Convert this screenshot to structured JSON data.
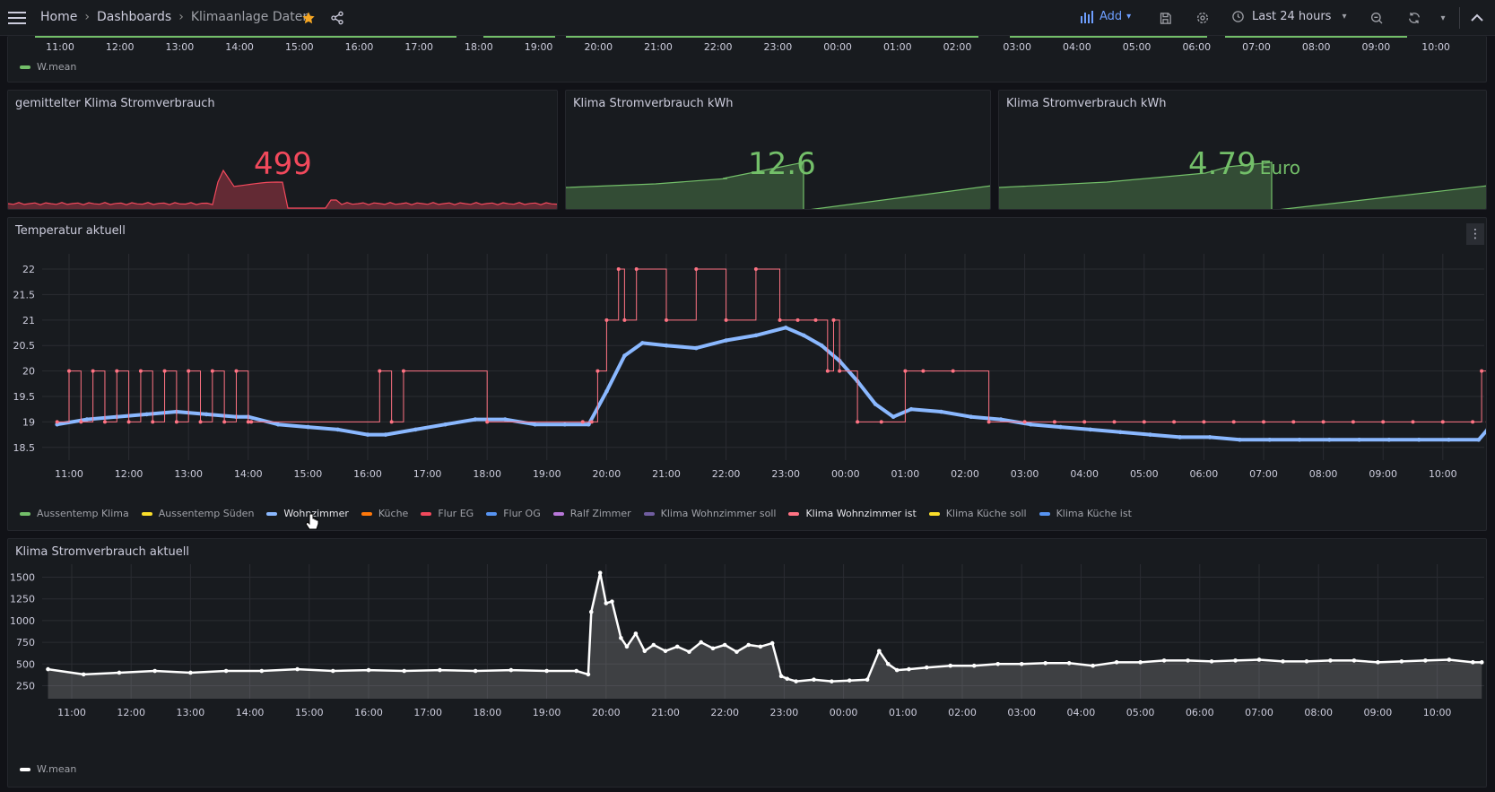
{
  "topbar": {
    "breadcrumbs": [
      "Home",
      "Dashboards",
      "Klimaanlage Daten"
    ],
    "add_label": "Add",
    "time_range": "Last 24 hours",
    "colors": {
      "accent": "#6e9fff",
      "star": "#f5a623"
    }
  },
  "time_ticks": [
    "11:00",
    "12:00",
    "13:00",
    "14:00",
    "15:00",
    "16:00",
    "17:00",
    "18:00",
    "19:00",
    "20:00",
    "21:00",
    "22:00",
    "23:00",
    "00:00",
    "01:00",
    "02:00",
    "03:00",
    "04:00",
    "05:00",
    "06:00",
    "07:00",
    "08:00",
    "09:00",
    "10:00"
  ],
  "top_panel": {
    "legend": [
      {
        "name": "W.mean",
        "color": "#73bf69"
      }
    ]
  },
  "stat_panels": [
    {
      "title": "gemittelter Klima Stromverbrauch",
      "value": "499",
      "unit": "",
      "color": "#f2495c"
    },
    {
      "title": "Klima Stromverbrauch kWh",
      "value": "12.6",
      "unit": "",
      "color": "#73bf69"
    },
    {
      "title": "Klima Stromverbrauch kWh",
      "value": "4.79",
      "unit": "Euro",
      "color": "#73bf69"
    }
  ],
  "temp_panel": {
    "title": "Temperatur aktuell",
    "legend": [
      {
        "name": "Aussentemp Klima",
        "color": "#73bf69",
        "active": false
      },
      {
        "name": "Aussentemp Süden",
        "color": "#fade2a",
        "active": false
      },
      {
        "name": "Wohnzimmer",
        "color": "#8ab8ff",
        "active": true
      },
      {
        "name": "Küche",
        "color": "#ff780a",
        "active": false
      },
      {
        "name": "Flur EG",
        "color": "#f2495c",
        "active": false
      },
      {
        "name": "Flur OG",
        "color": "#5794f2",
        "active": false
      },
      {
        "name": "Ralf Zimmer",
        "color": "#b877d9",
        "active": false
      },
      {
        "name": "Klima Wohnzimmer soll",
        "color": "#705da0",
        "active": false
      },
      {
        "name": "Klima Wohnzimmer ist",
        "color": "#ff7383",
        "active": true
      },
      {
        "name": "Klima Küche soll",
        "color": "#fade2a",
        "active": false
      },
      {
        "name": "Klima Küche ist",
        "color": "#5794f2",
        "active": false
      }
    ]
  },
  "power_panel": {
    "title": "Klima Stromverbrauch aktuell",
    "legend": [
      {
        "name": "W.mean",
        "color": "#ffffff"
      }
    ]
  },
  "chart_data": [
    {
      "type": "line",
      "title": "Temperatur aktuell",
      "x_unit": "hours since 11:00",
      "ylim": [
        18.25,
        22.3
      ],
      "yticks": [
        18.5,
        19,
        19.5,
        20,
        20.5,
        21,
        21.5,
        22
      ],
      "series": [
        {
          "name": "Wohnzimmer",
          "color": "#8ab8ff",
          "x": [
            -0.2,
            0.3,
            0.8,
            1.3,
            1.8,
            2.3,
            2.8,
            3.0,
            3.5,
            4.0,
            4.5,
            5.0,
            5.3,
            5.8,
            6.3,
            6.8,
            7.3,
            7.8,
            8.3,
            8.7,
            9.0,
            9.3,
            9.6,
            10.0,
            10.5,
            11.0,
            11.5,
            12.0,
            12.3,
            12.6,
            12.9,
            13.2,
            13.5,
            13.8,
            14.1,
            14.6,
            15.1,
            15.6,
            16.1,
            16.6,
            17.1,
            17.6,
            18.1,
            18.6,
            19.1,
            19.6,
            20.1,
            20.6,
            21.1,
            21.6,
            22.1,
            22.6,
            23.1,
            23.6,
            23.75
          ],
          "y": [
            18.95,
            19.05,
            19.1,
            19.15,
            19.2,
            19.15,
            19.1,
            19.1,
            18.95,
            18.9,
            18.85,
            18.75,
            18.75,
            18.85,
            18.95,
            19.05,
            19.05,
            18.95,
            18.95,
            18.95,
            19.6,
            20.3,
            20.55,
            20.5,
            20.45,
            20.6,
            20.7,
            20.85,
            20.7,
            20.5,
            20.2,
            19.8,
            19.35,
            19.1,
            19.25,
            19.2,
            19.1,
            19.05,
            18.95,
            18.9,
            18.85,
            18.8,
            18.75,
            18.7,
            18.7,
            18.65,
            18.65,
            18.65,
            18.65,
            18.65,
            18.65,
            18.65,
            18.65,
            18.65,
            18.85
          ]
        },
        {
          "name": "Klima Wohnzimmer ist",
          "color": "#ff7383",
          "x": [
            -0.2,
            0.0,
            0.2,
            0.4,
            0.6,
            0.8,
            1.0,
            1.2,
            1.4,
            1.6,
            1.8,
            2.0,
            2.2,
            2.4,
            2.6,
            2.8,
            3.0,
            3.05,
            5.2,
            5.4,
            5.6,
            7.0,
            8.6,
            8.75,
            8.85,
            9.0,
            9.2,
            9.3,
            9.5,
            10.0,
            10.5,
            11.0,
            11.5,
            11.9,
            12.2,
            12.5,
            12.7,
            12.8,
            12.9,
            13.2,
            13.6,
            14.0,
            14.3,
            14.8,
            15.4,
            16.0,
            16.5,
            17.0,
            17.5,
            18.0,
            18.5,
            19.0,
            19.5,
            20.0,
            20.5,
            21.0,
            21.5,
            22.0,
            22.5,
            23.0,
            23.5,
            23.65,
            23.75
          ],
          "y": [
            19,
            20,
            19,
            20,
            19,
            20,
            19,
            20,
            19,
            20,
            19,
            20,
            19,
            20,
            19,
            20,
            19,
            19,
            20,
            19,
            20,
            19,
            19,
            19,
            20,
            21,
            22,
            21,
            22,
            21,
            22,
            21,
            22,
            21,
            21,
            21,
            20,
            21,
            20,
            19,
            19,
            20,
            20,
            20,
            19,
            19,
            19,
            19,
            19,
            19,
            19,
            19,
            19,
            19,
            19,
            19,
            19,
            19,
            19,
            19,
            19,
            20,
            19
          ]
        }
      ]
    },
    {
      "type": "area",
      "title": "Klima Stromverbrauch aktuell",
      "x_unit": "hours since 11:00",
      "ylim": [
        100,
        1650
      ],
      "yticks": [
        250,
        500,
        750,
        1000,
        1250,
        1500
      ],
      "series": [
        {
          "name": "W.mean",
          "color": "#ffffff",
          "x": [
            -0.4,
            0.2,
            0.8,
            1.4,
            2.0,
            2.6,
            3.2,
            3.8,
            4.4,
            5.0,
            5.6,
            6.2,
            6.8,
            7.4,
            8.0,
            8.5,
            8.7,
            8.75,
            8.9,
            9.0,
            9.1,
            9.25,
            9.35,
            9.5,
            9.65,
            9.8,
            10.0,
            10.2,
            10.4,
            10.6,
            10.8,
            11.0,
            11.2,
            11.4,
            11.6,
            11.8,
            11.95,
            12.05,
            12.2,
            12.5,
            12.8,
            13.1,
            13.4,
            13.6,
            13.75,
            13.9,
            14.1,
            14.4,
            14.8,
            15.2,
            15.6,
            16.0,
            16.4,
            16.8,
            17.2,
            17.6,
            18.0,
            18.4,
            18.8,
            19.2,
            19.6,
            20.0,
            20.4,
            20.8,
            21.2,
            21.6,
            22.0,
            22.4,
            22.8,
            23.2,
            23.6,
            23.75
          ],
          "y": [
            440,
            380,
            400,
            420,
            400,
            420,
            420,
            440,
            420,
            430,
            420,
            430,
            420,
            430,
            420,
            420,
            380,
            1100,
            1550,
            1200,
            1220,
            800,
            700,
            850,
            650,
            720,
            650,
            700,
            640,
            750,
            680,
            720,
            640,
            720,
            700,
            740,
            360,
            330,
            300,
            320,
            300,
            310,
            320,
            650,
            500,
            430,
            440,
            460,
            480,
            480,
            500,
            500,
            510,
            510,
            480,
            520,
            520,
            540,
            540,
            530,
            540,
            550,
            530,
            530,
            540,
            540,
            520,
            530,
            540,
            550,
            520,
            520
          ]
        }
      ]
    }
  ]
}
